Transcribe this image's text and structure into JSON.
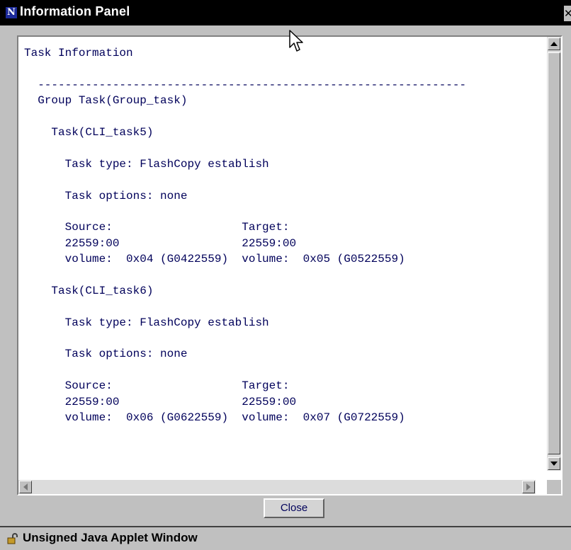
{
  "window": {
    "title": "Information Panel",
    "icon_letter": "N",
    "close_glyph": "✕"
  },
  "content": {
    "lines": [
      "Task Information",
      "",
      "  ---------------------------------------------------------------",
      "  Group Task(Group_task)",
      "",
      "    Task(CLI_task5)",
      "",
      "      Task type: FlashCopy establish",
      "",
      "      Task options: none",
      "",
      "      Source:                   Target:",
      "      22559:00                  22559:00",
      "      volume:  0x04 (G0422559)  volume:  0x05 (G0522559)",
      "",
      "    Task(CLI_task6)",
      "",
      "      Task type: FlashCopy establish",
      "",
      "      Task options: none",
      "",
      "      Source:                   Target:",
      "      22559:00                  22559:00",
      "      volume:  0x06 (G0622559)  volume:  0x07 (G0722559)"
    ]
  },
  "buttons": {
    "close_label": "Close"
  },
  "status": {
    "text": "Unsigned Java Applet Window"
  },
  "icons": {
    "title": "netscape-n-icon",
    "status": "unlocked-padlock-icon"
  },
  "colors": {
    "titlebar_bg": "#000000",
    "text_color": "#00005a",
    "window_bg": "#c0c0c0"
  }
}
